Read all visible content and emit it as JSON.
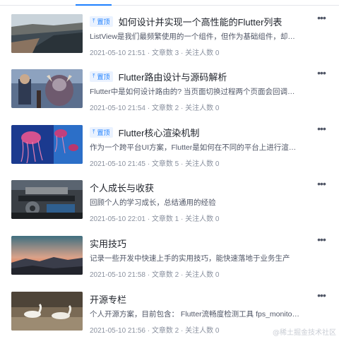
{
  "colors": {
    "accent": "#1e80ff",
    "pin_bg": "#eaf2ff",
    "meta": "#8a919f",
    "desc": "#515767"
  },
  "columns": [
    {
      "pinned": true,
      "pin_label": "置顶",
      "title": "如何设计并实现一个高性能的Flutter列表",
      "description": "ListView是我们最频繁使用的一个组件，但作为基础组件，却缺少一些...",
      "meta": "2021-05-10 21:51 · 文章数 3 · 关注人数 0",
      "thumbnail": "coastal-landscape"
    },
    {
      "pinned": true,
      "pin_label": "置顶",
      "title": "Flutter路由设计与源码解析",
      "description": "Flutter中是如何设计路由的? 当页面切换过程两个页面会回调哪些方法...",
      "meta": "2021-05-10 21:54 · 文章数 2 · 关注人数 0",
      "thumbnail": "game-characters"
    },
    {
      "pinned": true,
      "pin_label": "置顶",
      "title": "Flutter核心渲染机制",
      "description": "作为一个跨平台UI方案，Flutter是如何在不同的平台上进行渲染? 他的...",
      "meta": "2021-05-10 21:45 · 文章数 5 · 关注人数 0",
      "thumbnail": "jellyfish"
    },
    {
      "pinned": false,
      "pin_label": "",
      "title": "个人成长与收获",
      "description": "回顾个人的学习成长，总结通用的经验",
      "meta": "2021-05-10 22:01 · 文章数 1 · 关注人数 0",
      "thumbnail": "machinery"
    },
    {
      "pinned": false,
      "pin_label": "",
      "title": "实用技巧",
      "description": "记录一些开发中快速上手的实用技巧，能快速落地于业务生产",
      "meta": "2021-05-10 21:58 · 文章数 2 · 关注人数 0",
      "thumbnail": "sunset-mountains"
    },
    {
      "pinned": false,
      "pin_label": "",
      "title": "开源专栏",
      "description": "个人开源方案，目前包含： Flutter流畅度检测工具 fps_monitor Flutte...",
      "meta": "2021-05-10 21:56 · 文章数 2 · 关注人数 0",
      "thumbnail": "swans"
    }
  ],
  "more_icon": "more-dots-icon",
  "more_glyph": "•••",
  "watermark": "@稀土掘金技术社区"
}
